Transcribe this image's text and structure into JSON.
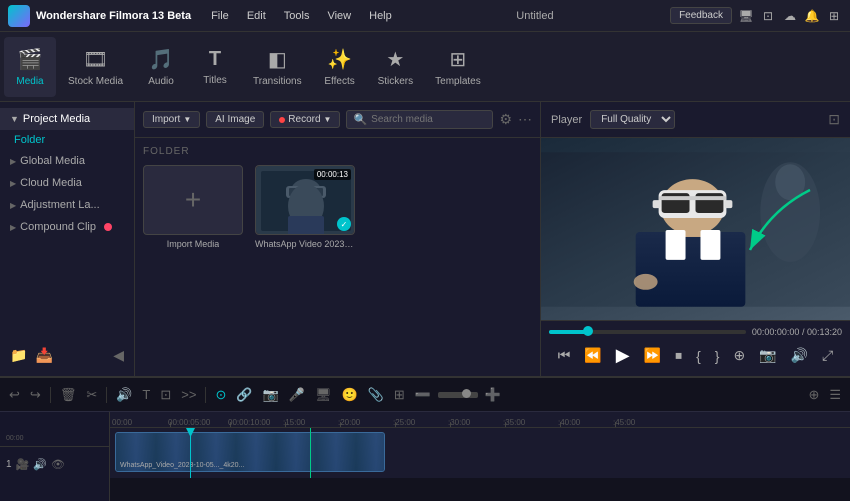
{
  "app": {
    "title": "Wondershare Filmora 13 Beta",
    "window_title": "Untitled"
  },
  "menu": {
    "items": [
      "File",
      "Edit",
      "Tools",
      "View",
      "Help"
    ]
  },
  "titlebar": {
    "feedback_btn": "Feedback"
  },
  "toolbar": {
    "items": [
      {
        "id": "media",
        "label": "Media",
        "icon": "🎬",
        "active": true
      },
      {
        "id": "stock_media",
        "label": "Stock Media",
        "icon": "🎞️",
        "active": false
      },
      {
        "id": "audio",
        "label": "Audio",
        "icon": "🎵",
        "active": false
      },
      {
        "id": "titles",
        "label": "Titles",
        "icon": "T",
        "active": false
      },
      {
        "id": "transitions",
        "label": "Transitions",
        "icon": "◧",
        "active": false
      },
      {
        "id": "effects",
        "label": "Effects",
        "icon": "✨",
        "active": false
      },
      {
        "id": "stickers",
        "label": "Stickers",
        "icon": "★",
        "active": false
      },
      {
        "id": "templates",
        "label": "Templates",
        "icon": "⊞",
        "active": false
      }
    ]
  },
  "left_panel": {
    "sections": [
      {
        "label": "Project Media",
        "active": true
      },
      {
        "label": "Folder",
        "active": true,
        "color": "teal"
      },
      {
        "label": "Global Media"
      },
      {
        "label": "Cloud Media"
      },
      {
        "label": "Adjustment La..."
      },
      {
        "label": "Compound Clip"
      }
    ]
  },
  "media_toolbar": {
    "import_btn": "Import",
    "ai_image_btn": "AI Image",
    "record_btn": "Record",
    "search_placeholder": "Search media"
  },
  "media": {
    "folder_header": "FOLDER",
    "items": [
      {
        "label": "Import Media",
        "type": "import"
      },
      {
        "label": "WhatsApp Video 2023-10-05...",
        "type": "video",
        "duration": "00:00:13"
      }
    ]
  },
  "player": {
    "label": "Player",
    "quality": "Full Quality",
    "time_current": "00:00:00:00",
    "time_total": "/ 00:13:20"
  },
  "timeline": {
    "toolbar_icons": [
      "undo",
      "redo",
      "scissors",
      "copy",
      "paste",
      "delete",
      "trim",
      "split",
      "zoom_out",
      "zoom_in",
      "more",
      "link",
      "camera",
      "microphone",
      "screen",
      "emoji",
      "hand",
      "scissor2",
      "grid",
      "add",
      "menu"
    ],
    "tracks": [
      {
        "id": 1,
        "label": "1",
        "icons": [
          "camera",
          "audio",
          "eye"
        ]
      }
    ],
    "time_markers": [
      "00:00:05:00",
      "00:00:10:00",
      "00:00:15:00",
      "00:00:20:00",
      "00:00:25:00",
      "00:00:30:00",
      "00:00:35:00",
      "00:00:40:00",
      "00:00:45:00"
    ],
    "clip_label": "WhatsApp_Video_2023-10-05..._4k20..."
  }
}
